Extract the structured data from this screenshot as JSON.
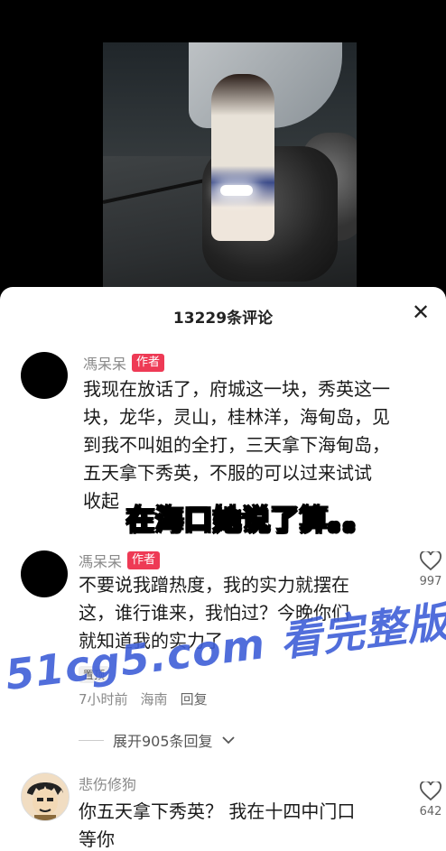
{
  "sheet": {
    "title": "13229条评论",
    "close_label": "✕"
  },
  "comments": [
    {
      "name": "馮呆呆",
      "tag": "作者",
      "lines": [
        "我现在放话了，府城这一块，秀英这一",
        "块，龙华，灵山，桂林洋，海甸岛，见",
        "到我不叫姐的全打，三天拿下海甸岛，",
        "五天拿下秀英，不服的可以过来试试",
        "收起"
      ]
    },
    {
      "name": "馮呆呆",
      "tag": "作者",
      "lines": [
        "不要说我蹭热度，我的实力就摆在",
        "这，谁行谁来，我怕过？今晚你们",
        "就知道我的实力了"
      ],
      "likes": "997",
      "pin": "置顶",
      "time": "7小时前",
      "location": "海南",
      "reply": "回复",
      "expand": "展开905条回复"
    },
    {
      "name": "悲伤修狗",
      "lines": [
        "你五天拿下秀英？ 我在十四中门口",
        "等你"
      ],
      "likes": "642"
    }
  ],
  "overlay": {
    "caption": "在海口她说了算。。",
    "watermark": "51cg5.com 看完整版"
  },
  "icons": [
    "heart-icon",
    "close-icon",
    "chevron-down-icon"
  ]
}
